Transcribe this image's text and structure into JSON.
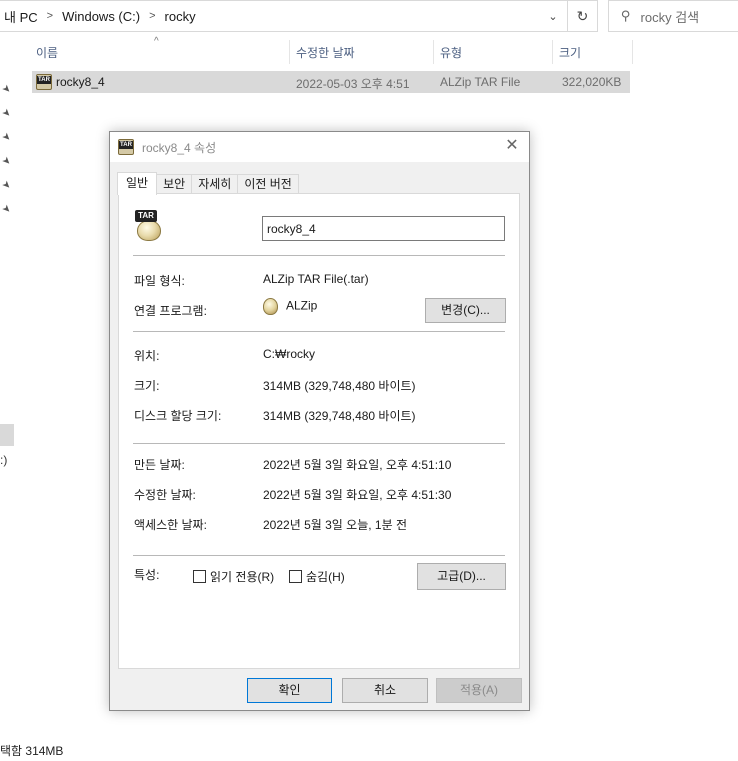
{
  "explorer": {
    "breadcrumb": [
      "내 PC",
      "Windows (C:)",
      "rocky"
    ],
    "search_placeholder": "rocky 검색",
    "columns": {
      "name": "이름",
      "modified": "수정한 날짜",
      "type": "유형",
      "size": "크기"
    },
    "file": {
      "name": "rocky8_4",
      "modified": "2022-05-03 오후 4:51",
      "type": "ALZip TAR File",
      "size": "322,020KB"
    },
    "left_fragment": ":)",
    "status": "택함 314MB"
  },
  "dialog": {
    "title": "rocky8_4 속성",
    "tabs": [
      "일반",
      "보안",
      "자세히",
      "이전 버전"
    ],
    "filename_value": "rocky8_4",
    "labels": {
      "file_type": "파일 형식:",
      "open_with": "연결 프로그램:",
      "location": "위치:",
      "size": "크기:",
      "size_on_disk": "디스크 할당 크기:",
      "created": "만든 날짜:",
      "modified": "수정한 날짜:",
      "accessed": "액세스한 날짜:",
      "attributes": "특성:"
    },
    "values": {
      "file_type": "ALZip TAR File(.tar)",
      "open_with": "ALZip",
      "location": "C:₩rocky",
      "size": "314MB (329,748,480 바이트)",
      "size_on_disk": "314MB (329,748,480 바이트)",
      "created": "2022년 5월 3일 화요일, 오후 4:51:10",
      "modified": "2022년 5월 3일 화요일, 오후 4:51:30",
      "accessed": "2022년 5월 3일 오늘, 1분 전"
    },
    "buttons": {
      "change": "변경(C)...",
      "advanced": "고급(D)...",
      "ok": "확인",
      "cancel": "취소",
      "apply": "적용(A)"
    },
    "checkboxes": {
      "readonly": "읽기 전용(R)",
      "hidden": "숨김(H)"
    },
    "icon_badge": "TAR"
  }
}
